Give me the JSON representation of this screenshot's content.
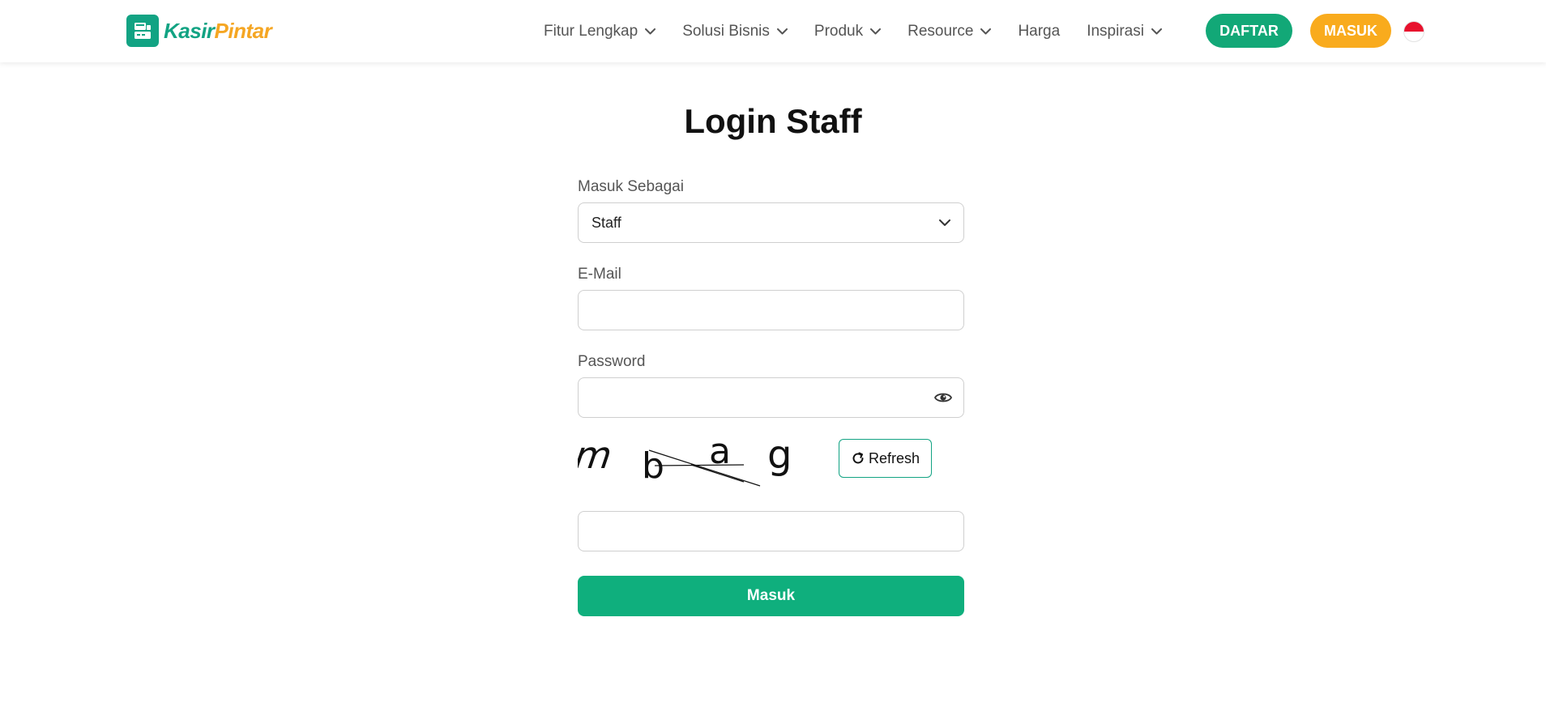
{
  "brand": {
    "logo_part1": "Kasir",
    "logo_part2": "Pintar",
    "logo_icon": "cash-register-icon",
    "primary_color": "#12a383",
    "accent_color": "#f9ab1d"
  },
  "nav": {
    "items": [
      {
        "label": "Fitur Lengkap",
        "has_dropdown": true
      },
      {
        "label": "Solusi Bisnis",
        "has_dropdown": true
      },
      {
        "label": "Produk",
        "has_dropdown": true
      },
      {
        "label": "Resource",
        "has_dropdown": true
      },
      {
        "label": "Harga",
        "has_dropdown": false
      },
      {
        "label": "Inspirasi",
        "has_dropdown": true
      }
    ],
    "daftar_label": "DAFTAR",
    "masuk_label": "MASUK",
    "language_flag": "indonesia-flag-icon"
  },
  "page": {
    "title": "Login Staff"
  },
  "form": {
    "role_label": "Masuk Sebagai",
    "role_value": "Staff",
    "email_label": "E-Mail",
    "email_value": "",
    "password_label": "Password",
    "password_value": "",
    "captcha_text": [
      "m",
      "b",
      "a",
      "g"
    ],
    "refresh_label": "Refresh",
    "captcha_input_value": "",
    "submit_label": "Masuk"
  }
}
